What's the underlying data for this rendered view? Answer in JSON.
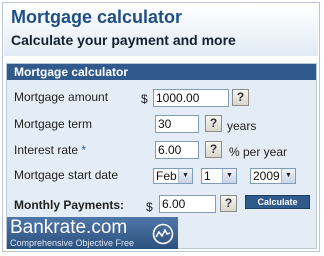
{
  "header": {
    "title": "Mortgage calculator",
    "subtitle": "Calculate your payment and more"
  },
  "panel": {
    "title": "Mortgage calculator"
  },
  "form": {
    "amount": {
      "label": "Mortgage amount",
      "prefix": "$",
      "value": "1000.00"
    },
    "term": {
      "label": "Mortgage term",
      "value": "30",
      "suffix": "years"
    },
    "rate": {
      "label": "Interest rate",
      "required_mark": "*",
      "value": "6.00",
      "suffix": "% per year"
    },
    "start_date": {
      "label": "Mortgage start date",
      "month": "Feb",
      "day": "1",
      "year": "2009"
    },
    "monthly": {
      "label": "Monthly Payments:",
      "prefix": "$",
      "value": "6.00"
    },
    "help_glyph": "?",
    "arrow_glyph": "▼",
    "calculate_label": "Calculate"
  },
  "brand": {
    "name": "Bankrate.com",
    "tagline": "Comprehensive  Objective  Free",
    "icon": "speedometer-icon"
  },
  "colors": {
    "title": "#1f4f86",
    "panel_header": "#315a8c",
    "panel_bg": "#e4edf5",
    "required": "#2b55a0"
  }
}
